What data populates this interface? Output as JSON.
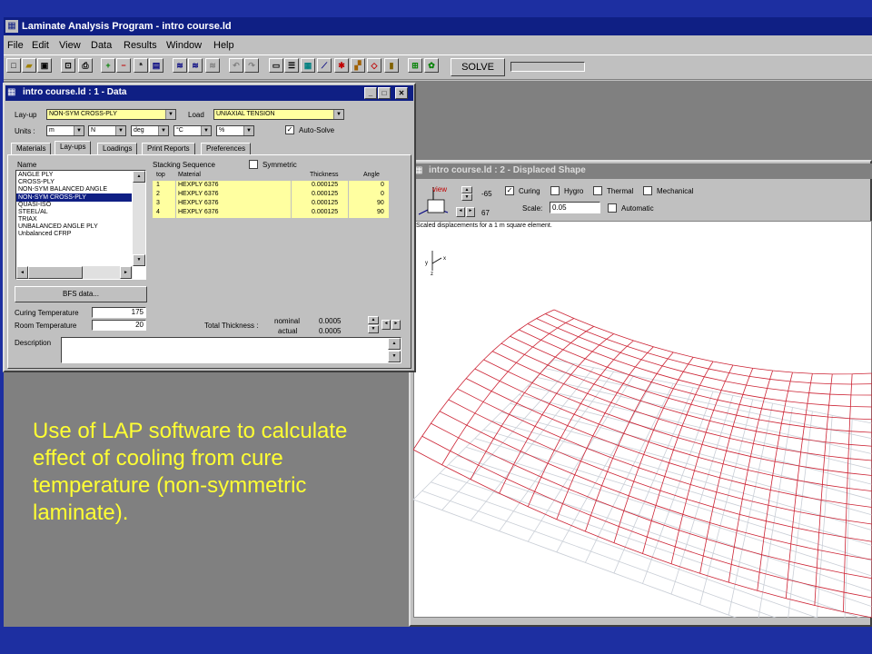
{
  "app": {
    "title": "Laminate Analysis Program - intro course.ld",
    "menu": [
      "File",
      "Edit",
      "View",
      "Data",
      "Results",
      "Window",
      "Help"
    ],
    "solve_label": "SOLVE"
  },
  "data_window": {
    "title": "intro course.ld : 1 - Data",
    "layup_label": "Lay-up",
    "layup_value": "NON-SYM CROSS-PLY",
    "load_label": "Load",
    "load_value": "UNIAXIAL TENSION",
    "units_label": "Units :",
    "units": [
      "m",
      "N",
      "deg",
      "°C",
      "%"
    ],
    "autosolve_label": "Auto-Solve",
    "tabs": [
      "Materials",
      "Lay-ups",
      "Loadings",
      "Print Reports",
      "Preferences"
    ],
    "name_header": "Name",
    "layups": [
      "ANGLE PLY",
      "CROSS-PLY",
      "NON-SYM BALANCED ANGLE",
      "NON-SYM CROSS-PLY",
      "QUASI-ISO",
      "STEEL/AL",
      "TRIAX",
      "UNBALANCED ANGLE PLY",
      "Unbalanced CFRP"
    ],
    "stacking_label": "Stacking Sequence",
    "symmetric_label": "Symmetric",
    "columns": [
      "top",
      "Material",
      "Thickness",
      "Angle"
    ],
    "rows": [
      [
        "1",
        "HEXPLY 6376",
        "0.000125",
        "0"
      ],
      [
        "2",
        "HEXPLY 6376",
        "0.000125",
        "0"
      ],
      [
        "3",
        "HEXPLY 6376",
        "0.000125",
        "90"
      ],
      [
        "4",
        "HEXPLY 6376",
        "0.000125",
        "90"
      ]
    ],
    "bfs_button": "BFS data...",
    "curing_label": "Curing Temperature",
    "curing_value": "175",
    "room_label": "Room Temperature",
    "room_value": "20",
    "total_thickness_label": "Total Thickness :",
    "nominal_label": "nominal",
    "nominal_value": "0.0005",
    "actual_label": "actual",
    "actual_value": "0.0005",
    "description_label": "Description"
  },
  "shape_window": {
    "title": "intro course.ld : 2 - Displaced Shape",
    "view_label": "view",
    "angle1": "-65",
    "angle2": "67",
    "curing_label": "Curing",
    "hygro_label": "Hygro",
    "thermal_label": "Thermal",
    "mechanical_label": "Mechanical",
    "scale_label": "Scale:",
    "scale_value": "0.05",
    "automatic_label": "Automatic",
    "note": "Scaled displacements for a 1 m square element."
  },
  "caption": "Use of LAP software to calculate effect of cooling from cure temperature (non-symmetric laminate).",
  "colors": {
    "title_bg": "#0f1f84",
    "mesh": "#cc2233",
    "caption": "#ffff33",
    "slide_bg": "#1d2fa1"
  }
}
